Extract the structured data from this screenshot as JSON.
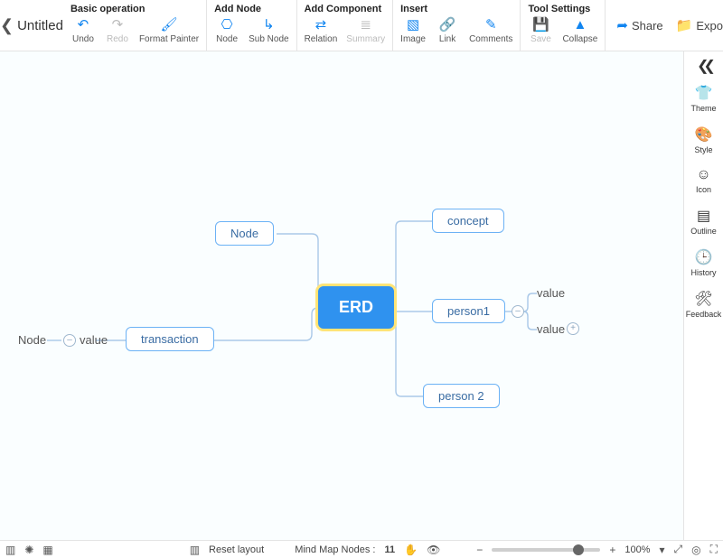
{
  "title": "Untitled",
  "ribbon": {
    "groups": [
      {
        "title": "Basic operation",
        "buttons": [
          {
            "name": "undo",
            "label": "Undo",
            "icon": "↶",
            "enabled": true
          },
          {
            "name": "redo",
            "label": "Redo",
            "icon": "↷",
            "enabled": false
          },
          {
            "name": "format-painter",
            "label": "Format Painter",
            "icon": "🖌",
            "enabled": true
          }
        ]
      },
      {
        "title": "Add Node",
        "buttons": [
          {
            "name": "node",
            "label": "Node",
            "icon": "⎔",
            "enabled": true
          },
          {
            "name": "sub-node",
            "label": "Sub Node",
            "icon": "↳",
            "enabled": true
          }
        ]
      },
      {
        "title": "Add Component",
        "buttons": [
          {
            "name": "relation",
            "label": "Relation",
            "icon": "⇄",
            "enabled": true
          },
          {
            "name": "summary",
            "label": "Summary",
            "icon": "≣",
            "enabled": false
          }
        ]
      },
      {
        "title": "Insert",
        "buttons": [
          {
            "name": "image",
            "label": "Image",
            "icon": "▧",
            "enabled": true
          },
          {
            "name": "link",
            "label": "Link",
            "icon": "🔗",
            "enabled": true
          },
          {
            "name": "comments",
            "label": "Comments",
            "icon": "✎",
            "enabled": true
          }
        ]
      },
      {
        "title": "Tool Settings",
        "buttons": [
          {
            "name": "save",
            "label": "Save",
            "icon": "💾",
            "enabled": false
          },
          {
            "name": "collapse",
            "label": "Collapse",
            "icon": "▲",
            "enabled": true
          }
        ]
      }
    ],
    "actions": [
      {
        "name": "share",
        "label": "Share",
        "icon": "➦"
      },
      {
        "name": "export",
        "label": "Export",
        "icon": "📁"
      }
    ]
  },
  "right_panel": {
    "items": [
      {
        "name": "theme",
        "label": "Theme",
        "icon": "👕"
      },
      {
        "name": "style",
        "label": "Style",
        "icon": "🎨"
      },
      {
        "name": "icon",
        "label": "Icon",
        "icon": "☺"
      },
      {
        "name": "outline",
        "label": "Outline",
        "icon": "▤"
      },
      {
        "name": "history",
        "label": "History",
        "icon": "🕒"
      },
      {
        "name": "feedback",
        "label": "Feedback",
        "icon": "🛠"
      }
    ]
  },
  "diagram": {
    "center": "ERD",
    "node_box": "Node",
    "transaction": "transaction",
    "concept": "concept",
    "person1": "person1",
    "person2": "person 2",
    "left_leaf_a": "Node",
    "left_leaf_b": "value",
    "right_leaf_a": "value",
    "right_leaf_b": "value"
  },
  "status": {
    "reset_layout": "Reset layout",
    "nodes_label": "Mind Map Nodes :",
    "nodes_count": "11",
    "zoom_pct": "100%",
    "slider_pos": 0.8
  }
}
